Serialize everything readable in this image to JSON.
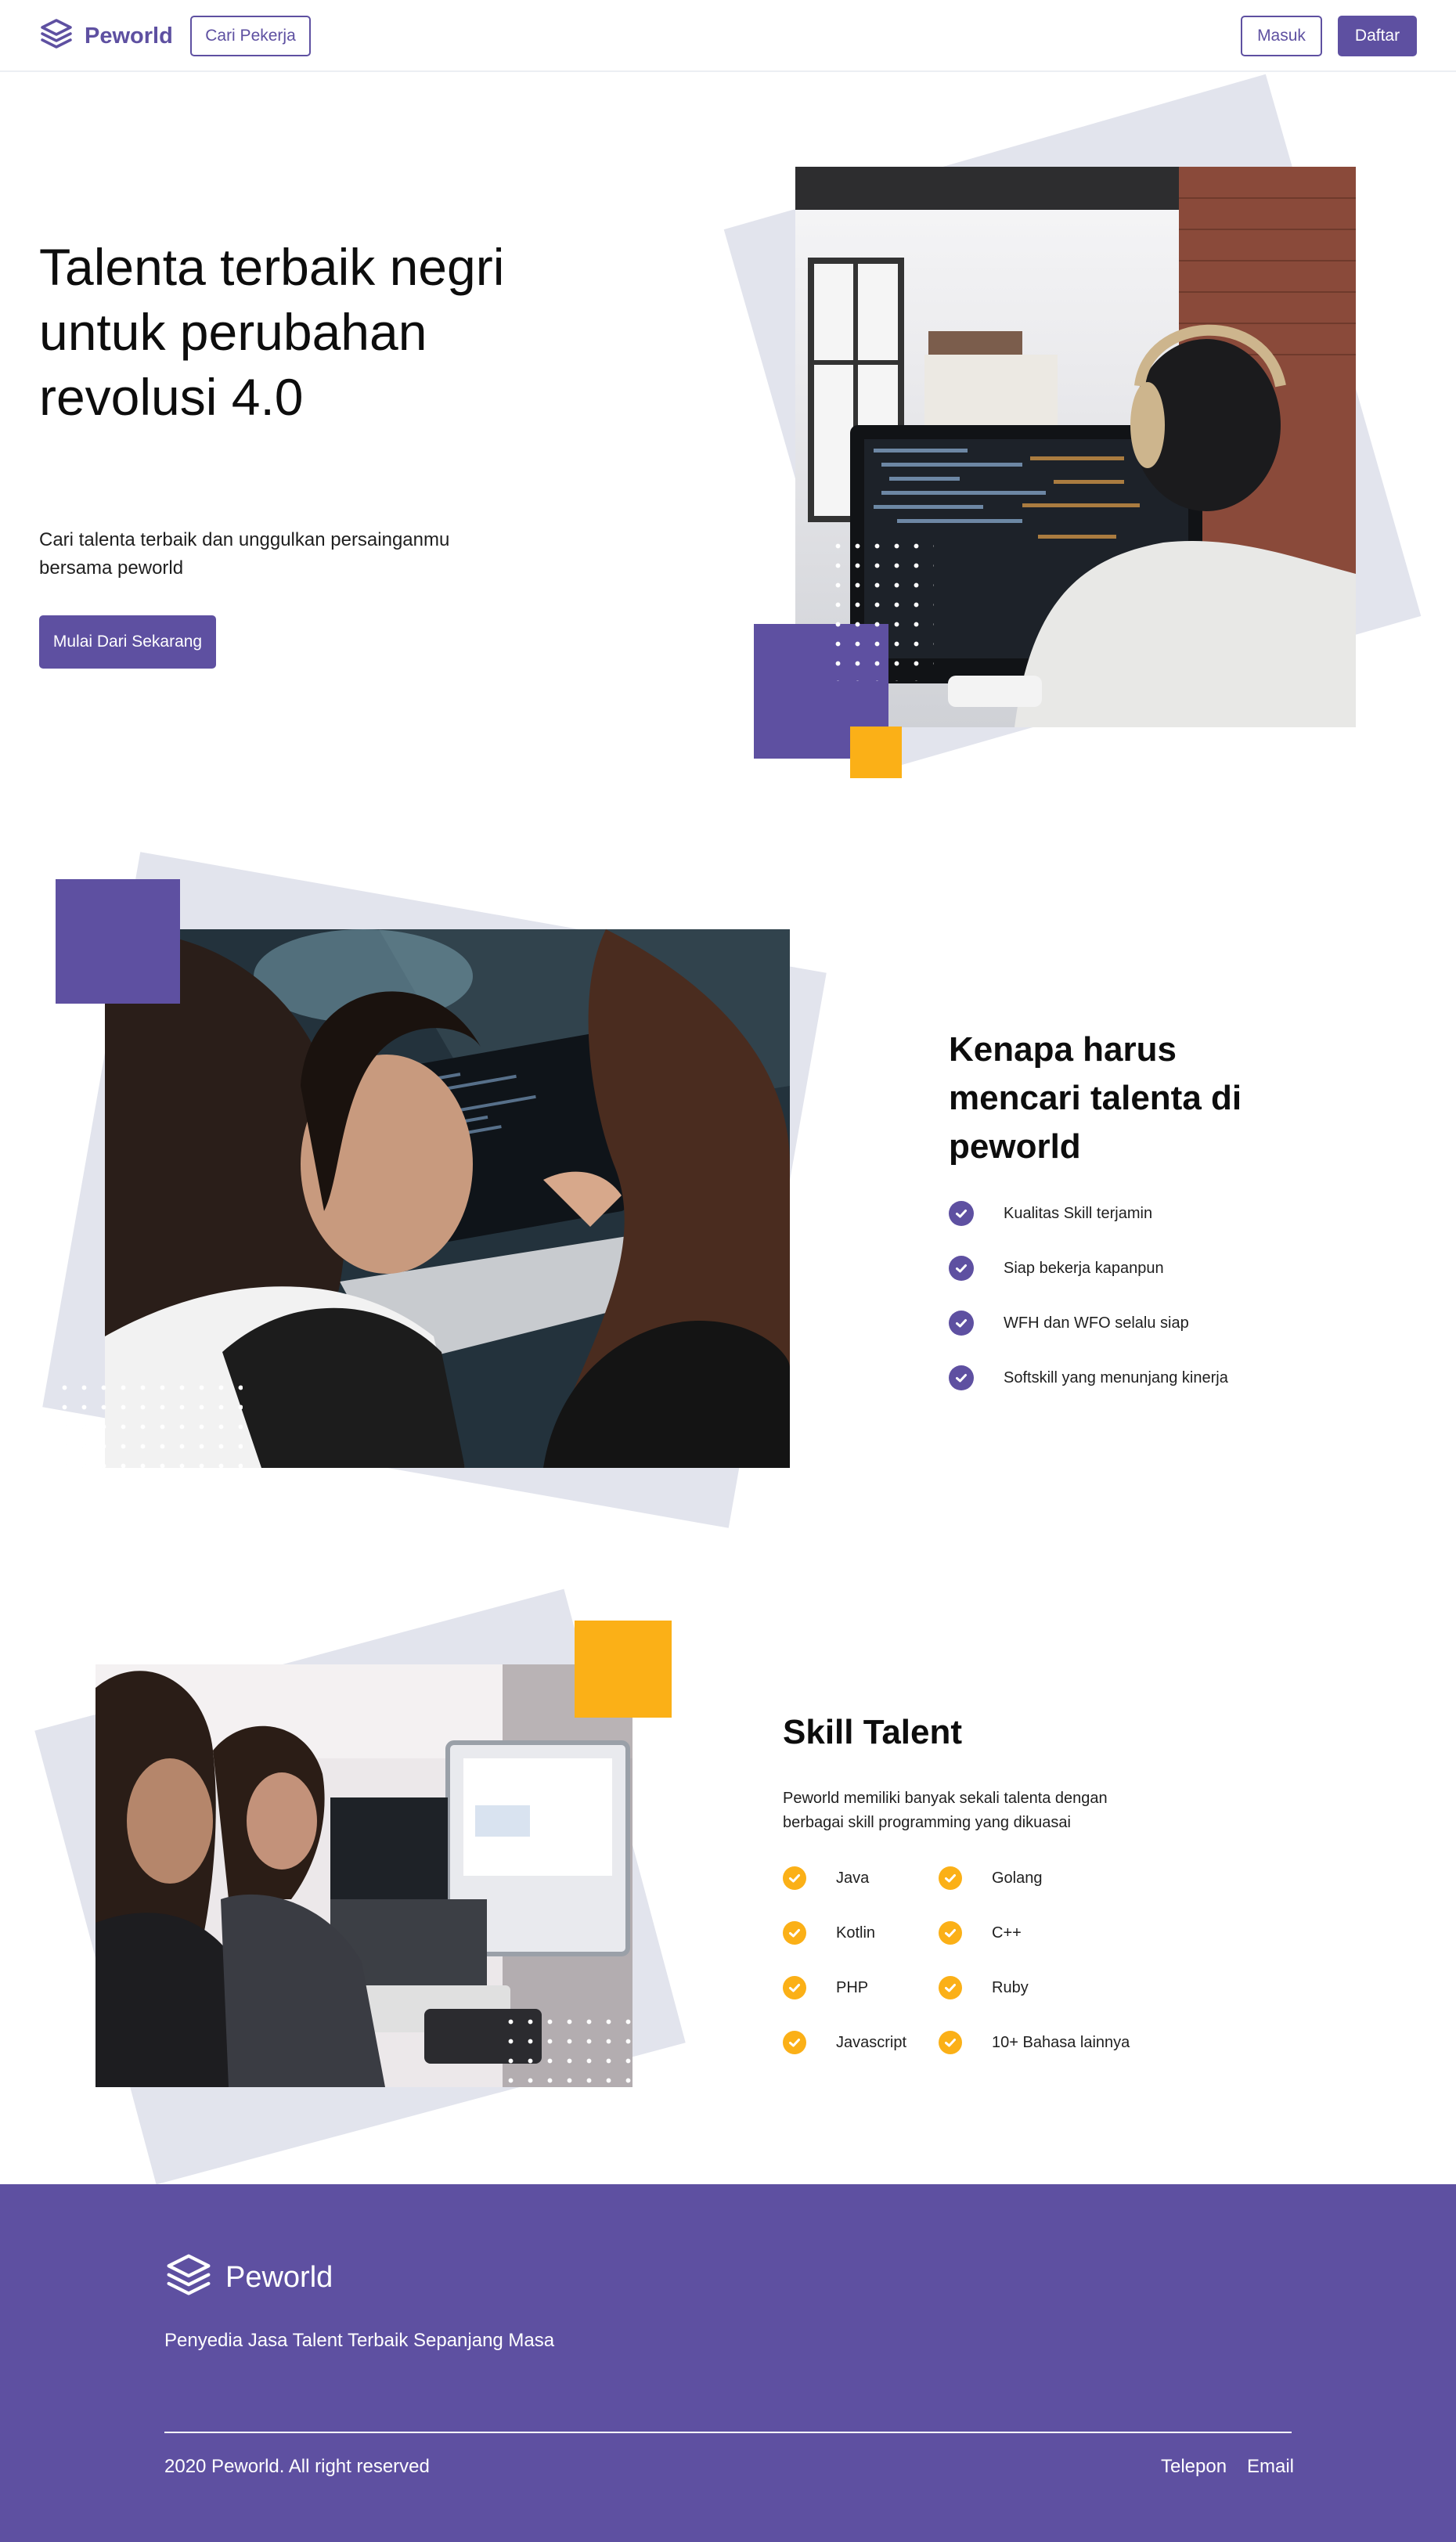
{
  "nav": {
    "brand": "Peworld",
    "find_worker": "Cari Pekerja",
    "login": "Masuk",
    "register": "Daftar"
  },
  "hero": {
    "title": "Talenta terbaik negri untuk perubahan revolusi 4.0",
    "subtitle": "Cari talenta terbaik dan unggulkan persainganmu bersama peworld",
    "cta": "Mulai Dari Sekarang"
  },
  "why": {
    "title": "Kenapa harus mencari talenta di peworld",
    "items": [
      "Kualitas Skill terjamin",
      "Siap bekerja kapanpun",
      "WFH dan WFO selalu siap",
      "Softskill yang menunjang kinerja"
    ]
  },
  "skills": {
    "title": "Skill Talent",
    "description": "Peworld memiliki banyak sekali talenta dengan berbagai skill programming yang dikuasai",
    "left": [
      "Java",
      "Kotlin",
      "PHP",
      "Javascript"
    ],
    "right": [
      "Golang",
      "C++",
      "Ruby",
      "10+ Bahasa lainnya"
    ]
  },
  "footer": {
    "brand": "Peworld",
    "tagline": "Penyedia Jasa Talent Terbaik Sepanjang Masa",
    "copyright": "2020 Peworld. All right reserved",
    "phone": "Telepon",
    "email": "Email"
  },
  "colors": {
    "primary": "#5e50a1",
    "accent": "#fbb017",
    "shape": "#e2e4ed"
  }
}
